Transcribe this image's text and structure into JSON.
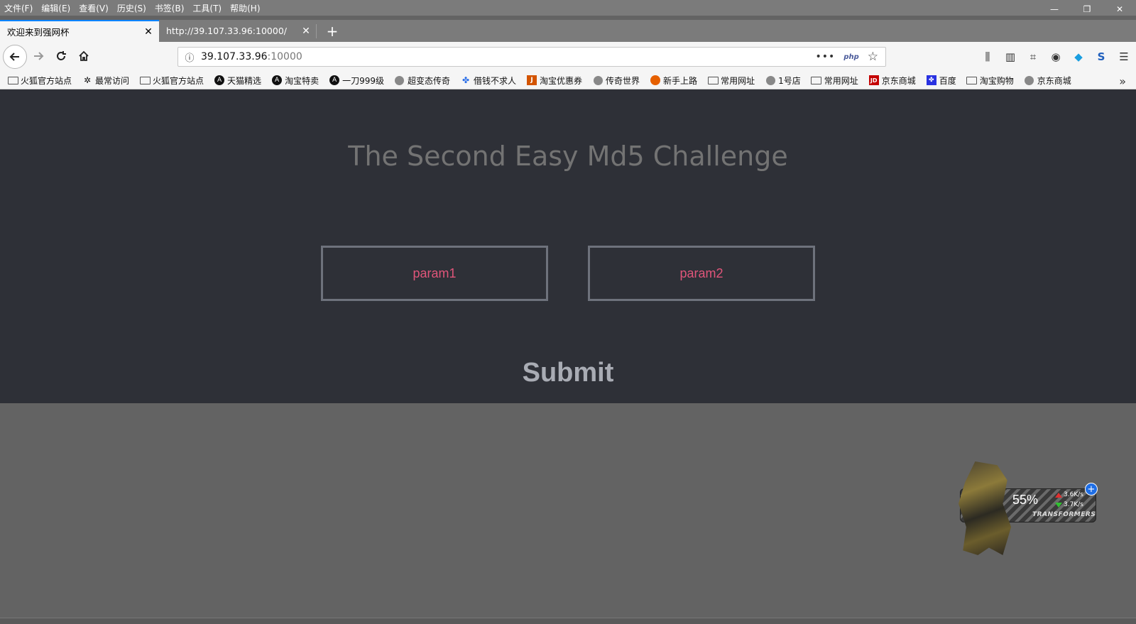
{
  "menubar": {
    "items": [
      "文件(F)",
      "编辑(E)",
      "查看(V)",
      "历史(S)",
      "书签(B)",
      "工具(T)",
      "帮助(H)"
    ]
  },
  "window_controls": {
    "minimize": "—",
    "restore": "❐",
    "close": "✕"
  },
  "tabs": [
    {
      "title": "欢迎来到强网杯",
      "active": true
    },
    {
      "title": "http://39.107.33.96:10000/",
      "active": false
    }
  ],
  "tab_close_icon": "✕",
  "new_tab_icon": "+",
  "navbar": {
    "url_host": "39.107.33.96",
    "url_port": ":10000",
    "page_actions_icon": "•••",
    "php_badge": "php"
  },
  "bookmarks": [
    {
      "label": "火狐官方站点",
      "icon": "folder"
    },
    {
      "label": "最常访问",
      "icon": "gear"
    },
    {
      "label": "火狐官方站点",
      "icon": "folder"
    },
    {
      "label": "天猫精选",
      "icon": "circle"
    },
    {
      "label": "淘宝特卖",
      "icon": "circle"
    },
    {
      "label": "一刀999级",
      "icon": "circle"
    },
    {
      "label": "超变态传奇",
      "icon": "globe"
    },
    {
      "label": "借钱不求人",
      "icon": "paw"
    },
    {
      "label": "淘宝优惠券",
      "icon": "tb"
    },
    {
      "label": "传奇世界",
      "icon": "globe"
    },
    {
      "label": "新手上路",
      "icon": "firefox"
    },
    {
      "label": "常用网址",
      "icon": "folder"
    },
    {
      "label": "1号店",
      "icon": "globe"
    },
    {
      "label": "常用网址",
      "icon": "folder"
    },
    {
      "label": "京东商城",
      "icon": "jd"
    },
    {
      "label": "百度",
      "icon": "baidu"
    },
    {
      "label": "淘宝购物",
      "icon": "folder"
    },
    {
      "label": "京东商城",
      "icon": "globe"
    }
  ],
  "page": {
    "title": "The Second Easy Md5 Challenge",
    "param1_placeholder": "param1",
    "param2_placeholder": "param2",
    "submit_label": "Submit"
  },
  "widget": {
    "percent": "55%",
    "upload_speed": "3.6K/s",
    "download_speed": "3.7K/s",
    "brand": "TRANSFORMERS"
  }
}
